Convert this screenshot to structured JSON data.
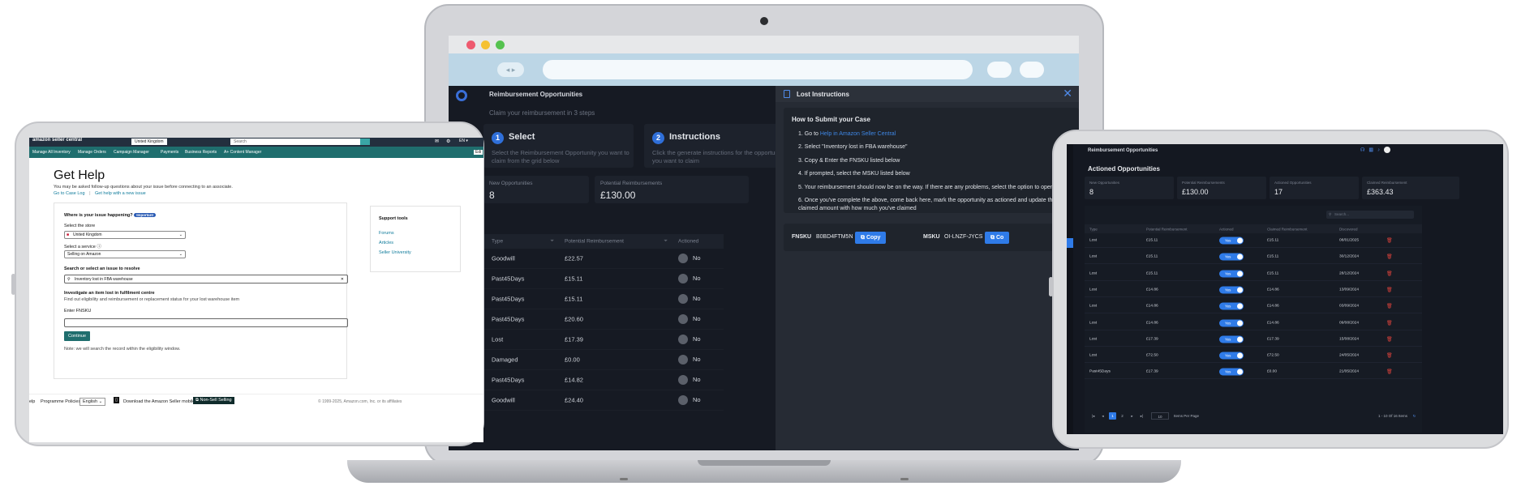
{
  "laptop": {
    "app_title": "Reimbursement Opportunities",
    "subtitle": "Claim your reimbursement in 3 steps",
    "steps": [
      {
        "num": "1",
        "title": "Select",
        "desc": "Select the Reimbursement Opportunity you want to claim from the grid below"
      },
      {
        "num": "2",
        "title": "Instructions",
        "desc": "Click the generate instructions for the opportunity you want to claim"
      }
    ],
    "stats": [
      {
        "label": "New Opportunities",
        "value": "8"
      },
      {
        "label": "Potential Reimbursements",
        "value": "£130.00"
      }
    ],
    "table": {
      "headers": [
        "Type",
        "Potential Reimbursement",
        "Actioned"
      ],
      "rows": [
        {
          "type": "Goodwill",
          "amount": "£22.57",
          "actioned": "No"
        },
        {
          "type": "Past45Days",
          "amount": "£15.11",
          "actioned": "No"
        },
        {
          "type": "Past45Days",
          "amount": "£15.11",
          "actioned": "No"
        },
        {
          "type": "Past45Days",
          "amount": "£20.60",
          "actioned": "No"
        },
        {
          "type": "Lost",
          "amount": "£17.39",
          "actioned": "No"
        },
        {
          "type": "Damaged",
          "amount": "£0.00",
          "actioned": "No"
        },
        {
          "type": "Past45Days",
          "amount": "£14.82",
          "actioned": "No"
        },
        {
          "type": "Goodwill",
          "amount": "£24.40",
          "actioned": "No"
        }
      ]
    },
    "panel": {
      "title": "Lost Instructions",
      "close": "✕",
      "howto_title": "How to Submit your Case",
      "step1_prefix": "1. Go to ",
      "step1_link": "Help in Amazon Seller Central",
      "step2": "2. Select \"Inventory lost in FBA warehouse\"",
      "step3": "3. Copy & Enter the FNSKU listed below",
      "step4": "4. If prompted, select the MSKU listed below",
      "step5": "5. Your reimbursement should now be on the way. If there are any problems, select the option to open a case",
      "step6": "6. Once you've complete the above, come back here, mark the opportunity as actioned and update the claimed amount with how much you've claimed",
      "fnsku_label": "FNSKU",
      "fnsku_value": "B0BD4FTM5N",
      "msku_label": "MSKU",
      "msku_value": "OI-LNZF-JYCS",
      "copy_label": "Copy",
      "copy_label_2": "Co"
    }
  },
  "seller_central": {
    "logo": "amazon seller central",
    "region": "United Kingdom",
    "search_placeholder": "Search",
    "lang": "EN ▾",
    "edit": "Edi",
    "nav": [
      "Manage All Inventory",
      "Manage Orders",
      "Campaign Manager",
      "Payments",
      "Business Reports",
      "A+ Content Manager"
    ],
    "title": "Get Help",
    "subtitle": "You may be asked follow-up questions about your issue before connecting to an associate.",
    "link_case_log": "Go to Case Log",
    "link_sep": "|",
    "link_new_issue": "Get help with a new issue",
    "where_label": "Where is your issue happening?",
    "important": "Important",
    "store_label": "Select the store",
    "store_value": "United Kingdom",
    "service_label": "Select a service",
    "service_value": "Selling on Amazon",
    "issue_label": "Search or select an issue to resolve",
    "issue_value": "Inventory lost in FBA warehouse",
    "investigate_title": "Investigate an item lost in fulfilment centre",
    "investigate_desc": "Find out eligibility and reimbursement or replacement status for your lost warehouse item",
    "fnsku_label": "Enter FNSKU",
    "continue": "Continue",
    "note": "Note: we will search the record within the eligibility window.",
    "support_title": "Support tools",
    "support_links": [
      "Forums",
      "Articles",
      "Seller University"
    ],
    "footer": {
      "help": "elp",
      "policies": "Programme Policies",
      "lang": "English",
      "app": "Download the Amazon Seller mobile app",
      "non_selling": "Non-Sell Selling",
      "copyright": "© 1999-2025, Amazon.com, Inc. or its affiliates"
    }
  },
  "tablet_right": {
    "app_title": "Reimbursement Opportunities",
    "heading": "Actioned Opportunities",
    "stats": [
      {
        "label": "New Opportunities",
        "value": "8"
      },
      {
        "label": "Potential Reimbursements",
        "value": "£130.00"
      },
      {
        "label": "Actioned Opportunities",
        "value": "17"
      },
      {
        "label": "Claimed Reimbursement",
        "value": "£363.43"
      }
    ],
    "search_placeholder": "Search...",
    "headers": [
      "Type",
      "Potential Reimbursement",
      "Actioned",
      "Claimed Reimbursement",
      "Discovered"
    ],
    "rows": [
      {
        "type": "Lost",
        "potential": "£15.11",
        "actioned": "Yes",
        "claimed": "£15.11",
        "date": "08/01/2025"
      },
      {
        "type": "Lost",
        "potential": "£15.11",
        "actioned": "Yes",
        "claimed": "£15.11",
        "date": "30/12/2024"
      },
      {
        "type": "Lost",
        "potential": "£15.11",
        "actioned": "Yes",
        "claimed": "£15.11",
        "date": "28/12/2024"
      },
      {
        "type": "Lost",
        "potential": "£14.86",
        "actioned": "Yes",
        "claimed": "£14.86",
        "date": "13/09/2024"
      },
      {
        "type": "Lost",
        "potential": "£14.86",
        "actioned": "Yes",
        "claimed": "£14.86",
        "date": "03/09/2024"
      },
      {
        "type": "Lost",
        "potential": "£14.86",
        "actioned": "Yes",
        "claimed": "£14.86",
        "date": "09/08/2024"
      },
      {
        "type": "Lost",
        "potential": "£17.39",
        "actioned": "Yes",
        "claimed": "£17.39",
        "date": "15/08/2024"
      },
      {
        "type": "Lost",
        "potential": "£72.50",
        "actioned": "Yes",
        "claimed": "£72.50",
        "date": "24/05/2024"
      },
      {
        "type": "Past45Days",
        "potential": "£17.39",
        "actioned": "Yes",
        "claimed": "£0.00",
        "date": "21/05/2024"
      }
    ],
    "pager": {
      "first": "|◂",
      "prev": "◂",
      "pages": [
        "1",
        "2"
      ],
      "next": "▸",
      "last": "▸|",
      "per_page": "10",
      "per_page_label": "Items Per Page",
      "range": "1 - 10 Of 16 Items"
    }
  }
}
